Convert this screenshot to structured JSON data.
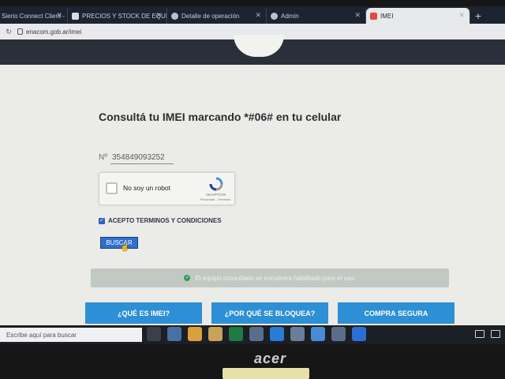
{
  "browser": {
    "tabs": [
      {
        "label": "Sierio Connect Client - I",
        "icon": "app-icon"
      },
      {
        "label": "PRECIOS Y STOCK DE EQUIPO",
        "icon": "doc-icon"
      },
      {
        "label": "Detalle de operación",
        "icon": "globe-icon"
      },
      {
        "label": "Admin",
        "icon": "globe-icon"
      },
      {
        "label": "IMEI",
        "icon": "enacom-icon"
      }
    ],
    "url": "enacom.gob.ar/imei"
  },
  "page": {
    "title": "Consultá tu IMEI marcando *#06# en tu celular",
    "imei_label": "Nº",
    "imei_value": "354849093252",
    "recaptcha": {
      "label": "No soy un robot",
      "brand": "reCAPTCHA",
      "links": "Privacidad - Términos"
    },
    "terms_label": "ACEPTO TERMINOS Y CONDICIONES",
    "terms_checked": true,
    "search_button": "BUSCAR",
    "result_message": "El equipo consultado se encuentra habilitado para el uso.",
    "info_buttons": [
      "¿QUÉ ES IMEI?",
      "¿POR QUÉ SE BLOQUEA?",
      "COMPRA SEGURA"
    ]
  },
  "taskbar": {
    "search_placeholder": "Escribe aquí para buscar"
  },
  "monitor": {
    "brand": "acer"
  },
  "colors": {
    "accent": "#2d8fd6",
    "header": "#2b2f3a",
    "success": "#2e9e5a"
  }
}
